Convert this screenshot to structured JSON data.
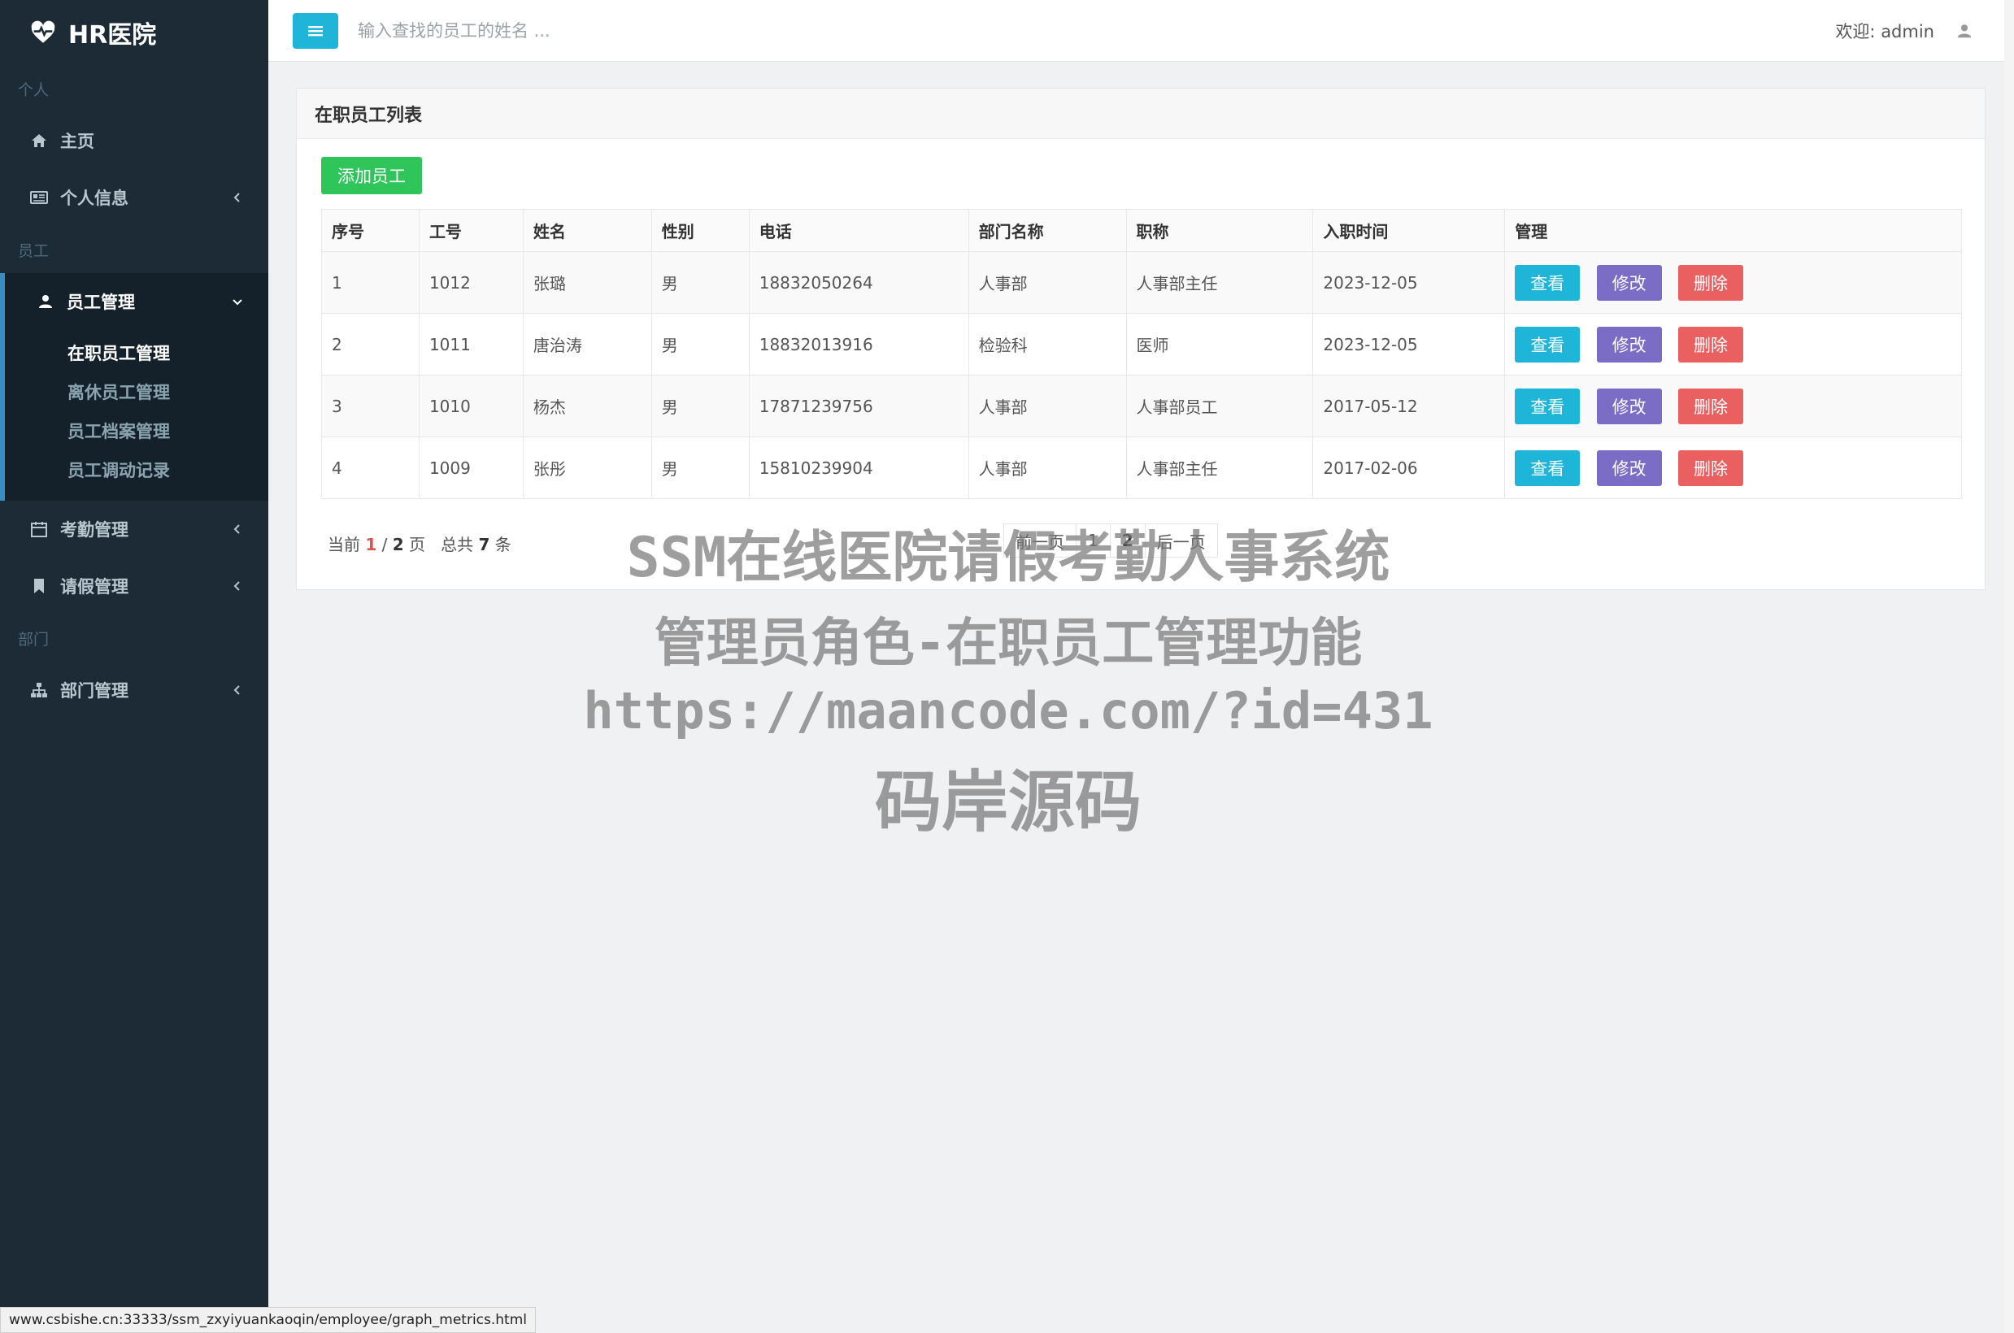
{
  "brand": {
    "title": "HR医院"
  },
  "sidebar": {
    "section_personal": "个人",
    "home": "主页",
    "profile": "个人信息",
    "section_staff": "员工",
    "staff_mgmt": "员工管理",
    "staff_sub": [
      "在职员工管理",
      "离休员工管理",
      "员工档案管理",
      "员工调动记录"
    ],
    "attendance": "考勤管理",
    "leave": "请假管理",
    "section_dept": "部门",
    "dept_mgmt": "部门管理"
  },
  "header": {
    "search_placeholder": "输入查找的员工的姓名 ...",
    "welcome": "欢迎: admin"
  },
  "panel": {
    "title": "在职员工列表",
    "add_button": "添加员工",
    "columns": [
      "序号",
      "工号",
      "姓名",
      "性别",
      "电话",
      "部门名称",
      "职称",
      "入职时间",
      "管理"
    ],
    "rows": [
      [
        "1",
        "1012",
        "张璐",
        "男",
        "18832050264",
        "人事部",
        "人事部主任",
        "2023-12-05"
      ],
      [
        "2",
        "1011",
        "唐治涛",
        "男",
        "18832013916",
        "检验科",
        "医师",
        "2023-12-05"
      ],
      [
        "3",
        "1010",
        "杨杰",
        "男",
        "17871239756",
        "人事部",
        "人事部员工",
        "2017-05-12"
      ],
      [
        "4",
        "1009",
        "张彤",
        "男",
        "15810239904",
        "人事部",
        "人事部主任",
        "2017-02-06"
      ]
    ],
    "actions": {
      "view": "查看",
      "edit": "修改",
      "delete": "删除"
    },
    "pager": {
      "prefix": "当前",
      "current": "1",
      "sep": "/",
      "total_pages": "2",
      "page_unit": "页",
      "total_prefix": "总共",
      "total_count": "7",
      "count_unit": "条",
      "prev": "前一页",
      "pages": [
        "1",
        "2"
      ],
      "next": "后一页"
    }
  },
  "watermark": {
    "line1": "SSM在线医院请假考勤人事系统",
    "line2": "管理员角色-在职员工管理功能",
    "line3": "https://maancode.com/?id=431",
    "line4": "码岸源码"
  },
  "status_url": "www.csbishe.cn:33333/ssm_zxyiyuankaoqin/employee/graph_metrics.html",
  "colors": {
    "sidebar_bg": "#1c2b36",
    "accent": "#3c8dbc",
    "view_btn": "#1fb5d8",
    "edit_btn": "#7b6cc6",
    "delete_btn": "#ea5f5f",
    "add_btn": "#2ec55a"
  },
  "icons": {
    "brand": "heartbeat-icon",
    "home": "home-icon",
    "profile": "id-card-icon",
    "staff": "user-icon",
    "attendance": "calendar-icon",
    "leave": "bookmark-icon",
    "dept": "sitemap-icon",
    "toggle": "menu-bars-icon",
    "user": "user-icon"
  }
}
